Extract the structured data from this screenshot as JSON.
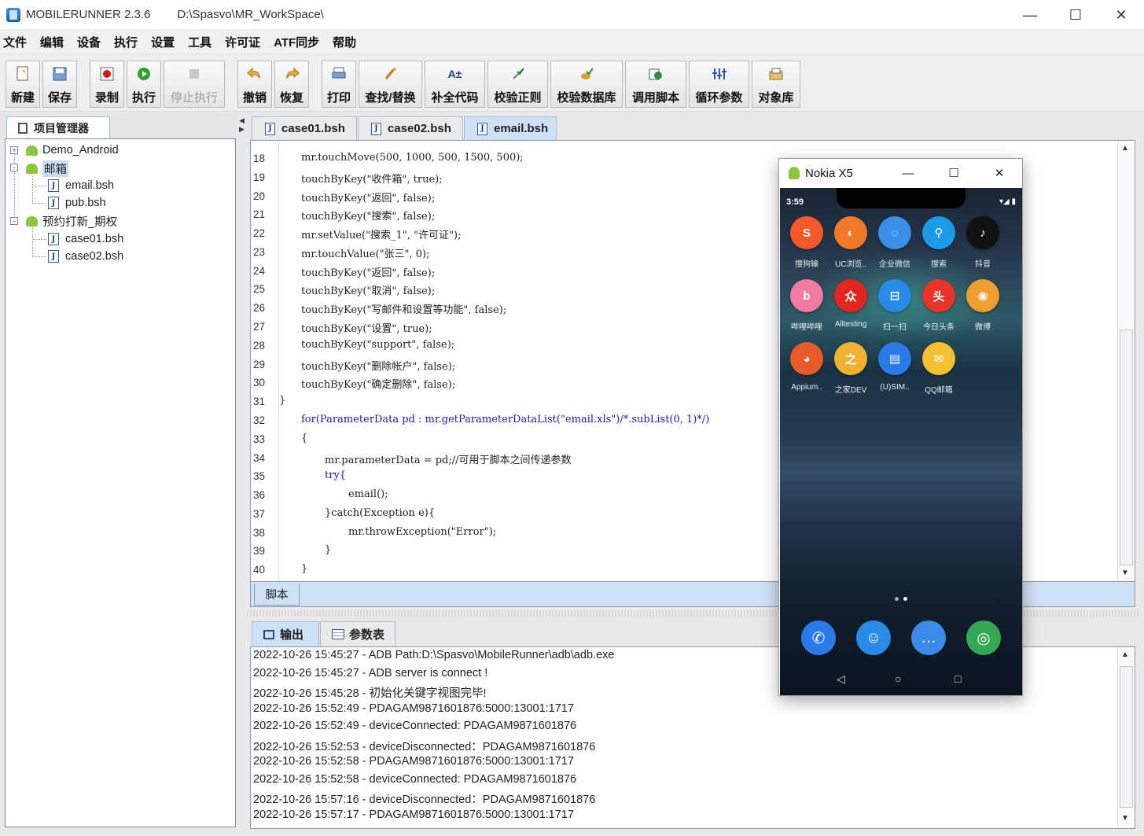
{
  "window": {
    "title": "MOBILERUNNER 2.3.6",
    "workspace": "D:\\Spasvo\\MR_WorkSpace\\",
    "minimize": "—",
    "maximize": "☐",
    "close": "✕"
  },
  "menu": [
    "文件",
    "编辑",
    "设备",
    "执行",
    "设置",
    "工具",
    "许可证",
    "ATF同步",
    "帮助"
  ],
  "toolbar": {
    "new": "新建",
    "save": "保存",
    "record": "录制",
    "run": "执行",
    "stop": "停止执行",
    "undo": "撤销",
    "redo": "恢复",
    "print": "打印",
    "find_replace": "查找/替换",
    "complete_code": "补全代码",
    "check_regex": "校验正则",
    "check_db": "校验数据库",
    "call_script": "调用脚本",
    "loop_params": "循环参数",
    "object_lib": "对象库"
  },
  "project": {
    "tab_label": "项目管理器",
    "tree": [
      {
        "label": "Demo_Android",
        "expander": "+"
      },
      {
        "label": "邮箱",
        "expander": "-"
      },
      {
        "label": "email.bsh"
      },
      {
        "label": "pub.bsh"
      },
      {
        "label": "预约打新_期权",
        "expander": "-"
      },
      {
        "label": "case01.bsh"
      },
      {
        "label": "case02.bsh"
      }
    ]
  },
  "editor": {
    "tabs": [
      "case01.bsh",
      "case02.bsh",
      "email.bsh"
    ],
    "active_tab": "email.bsh",
    "bottom_tab": "脚本",
    "line_numbers": [
      "18",
      "19",
      "20",
      "21",
      "22",
      "23",
      "24",
      "25",
      "26",
      "27",
      "28",
      "29",
      "30",
      "31",
      "32",
      "33",
      "34",
      "35",
      "36",
      "37",
      "38",
      "39",
      "40"
    ],
    "code": [
      "mr.touchMove(500, 1000, 500, 1500, 500);",
      "touchByKey(\"收件箱\", true);",
      "touchByKey(\"返回\", false);",
      "touchByKey(\"搜索\", false);",
      "mr.setValue(\"搜索_1\", \"许可证\");",
      "mr.touchValue(\"张三\", 0);",
      "touchByKey(\"返回\", false);",
      "touchByKey(\"取消\", false);",
      "touchByKey(\"写邮件和设置等功能\", false);",
      "touchByKey(\"设置\", true);",
      "touchByKey(\"support\", false);",
      "touchByKey(\"删除帐户\", false);",
      "touchByKey(\"确定删除\", false);",
      "}",
      "for(ParameterData pd : mr.getParameterDataList(\"email.xls\")/*.subList(0, 1)*/)",
      "{",
      "mr.parameterData = pd;//可用于脚本之间传递参数",
      "try{",
      "email();",
      "}catch(Exception e){",
      "mr.throwException(\"Error\");",
      "}",
      "}"
    ]
  },
  "output": {
    "tabs": [
      "输出",
      "参数表"
    ],
    "lines": [
      "2022-10-26 15:45:27 - ADB Path:D:\\Spasvo\\MobileRunner\\adb\\adb.exe",
      "2022-10-26 15:45:27 - ADB server is connect !",
      "2022-10-26 15:45:28 - 初始化关键字视图完毕!",
      "2022-10-26 15:52:49 - PDAGAM9871601876:5000:13001:1717",
      "2022-10-26 15:52:49 - deviceConnected: PDAGAM9871601876",
      "2022-10-26 15:52:53 - deviceDisconnected：PDAGAM9871601876",
      "2022-10-26 15:52:58 - PDAGAM9871601876:5000:13001:1717",
      "2022-10-26 15:52:58 - deviceConnected: PDAGAM9871601876",
      "2022-10-26 15:57:16 - deviceDisconnected：PDAGAM9871601876",
      "2022-10-26 15:57:17 - PDAGAM9871601876:5000:13001:1717"
    ]
  },
  "phone": {
    "title": "Nokia X5",
    "status_time": "3:59",
    "status_right": "▾◢ ▮",
    "apps": [
      {
        "label": "搜狗输",
        "glyph": "S",
        "color": "#f25a2a"
      },
      {
        "label": "UC浏览..",
        "glyph": "◐",
        "color": "#f07a2a"
      },
      {
        "label": "企业微信",
        "glyph": "◌",
        "color": "#3a8fe8"
      },
      {
        "label": "搜索",
        "glyph": "⚲",
        "color": "#1a9ae8"
      },
      {
        "label": "抖音",
        "glyph": "♪",
        "color": "#111111"
      },
      {
        "label": "哔哩哔哩",
        "glyph": "b",
        "color": "#f07aa0"
      },
      {
        "label": "Alltesting",
        "glyph": "众",
        "color": "#e2261f"
      },
      {
        "label": "扫一扫",
        "glyph": "⊟",
        "color": "#2a8ae8"
      },
      {
        "label": "今日头条",
        "glyph": "头",
        "color": "#e8332a"
      },
      {
        "label": "微博",
        "glyph": "◉",
        "color": "#f0a030"
      },
      {
        "label": "Appium..",
        "glyph": "◕",
        "color": "#e85a2a"
      },
      {
        "label": "之家DEV",
        "glyph": "之",
        "color": "#f0b030"
      },
      {
        "label": "(U)SIM..",
        "glyph": "▤",
        "color": "#2a7ae8"
      },
      {
        "label": "QQ邮箱",
        "glyph": "✉",
        "color": "#f5c030"
      }
    ],
    "dock": [
      {
        "name": "phone",
        "glyph": "✆",
        "color": "#2a7ae8"
      },
      {
        "name": "contacts",
        "glyph": "☺",
        "color": "#2a8ae8"
      },
      {
        "name": "messages",
        "glyph": "…",
        "color": "#3a8ae8"
      },
      {
        "name": "chrome",
        "glyph": "◎",
        "color": "#34a853"
      }
    ],
    "nav": {
      "back": "◁",
      "home": "○",
      "recent": "□"
    }
  }
}
